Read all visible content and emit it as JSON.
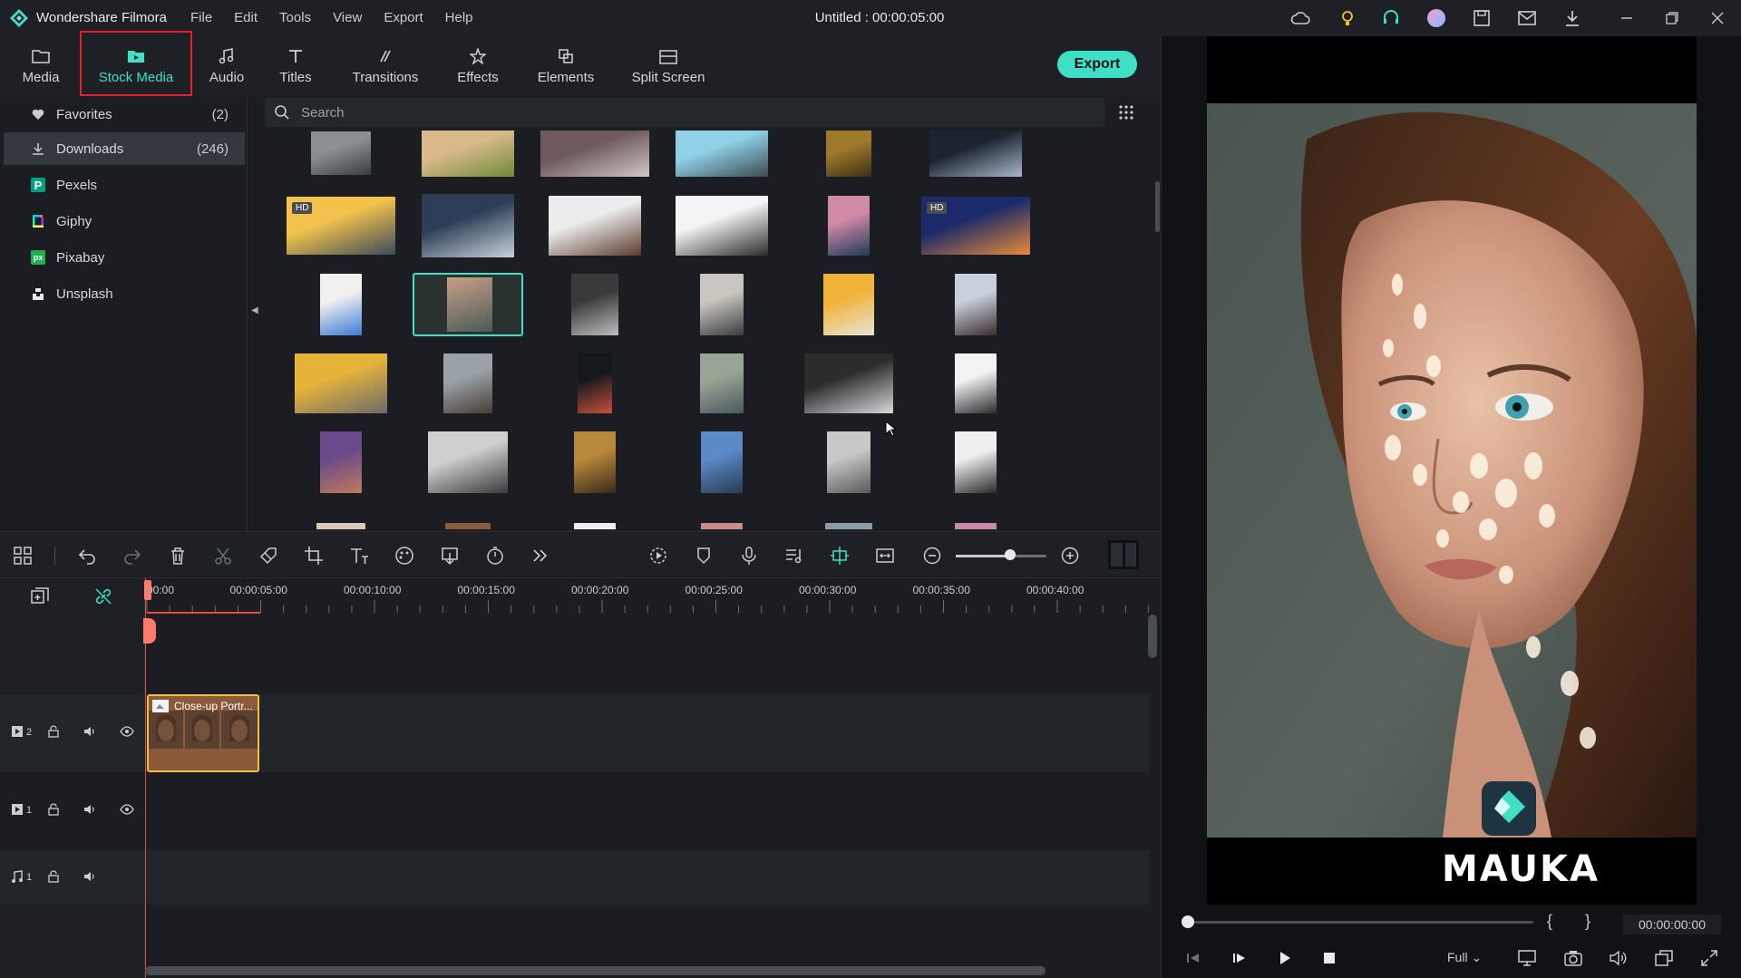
{
  "app": {
    "name": "Wondershare Filmora",
    "doc_title": "Untitled : 00:00:05:00",
    "menu": [
      "File",
      "Edit",
      "Tools",
      "View",
      "Export",
      "Help"
    ],
    "title_icons": [
      "cloud-icon",
      "bulb-icon",
      "headset-icon",
      "avatar-icon",
      "save-icon",
      "mail-icon",
      "download-icon"
    ],
    "window_controls": [
      "minimize-icon",
      "restore-icon",
      "close-icon"
    ]
  },
  "library_tabs": [
    {
      "label": "Media",
      "icon": "folder-icon",
      "active": false
    },
    {
      "label": "Stock Media",
      "icon": "stock-media-icon",
      "active": true
    },
    {
      "label": "Audio",
      "icon": "music-note-icon",
      "active": false
    },
    {
      "label": "Titles",
      "icon": "text-t-icon",
      "active": false
    },
    {
      "label": "Transitions",
      "icon": "transition-icon",
      "active": false
    },
    {
      "label": "Effects",
      "icon": "effects-icon",
      "active": false
    },
    {
      "label": "Elements",
      "icon": "elements-icon",
      "active": false
    },
    {
      "label": "Split Screen",
      "icon": "split-screen-icon",
      "active": false
    }
  ],
  "export_label": "Export",
  "sidebar": {
    "items": [
      {
        "label": "Favorites",
        "count": "(2)",
        "icon": "heart-icon",
        "active": false
      },
      {
        "label": "Downloads",
        "count": "(246)",
        "icon": "download-icon",
        "active": true
      },
      {
        "label": "Pexels",
        "count": "",
        "icon": "pexels-icon",
        "active": false
      },
      {
        "label": "Giphy",
        "count": "",
        "icon": "giphy-icon",
        "active": false
      },
      {
        "label": "Pixabay",
        "count": "",
        "icon": "pixabay-icon",
        "active": false
      },
      {
        "label": "Unsplash",
        "count": "",
        "icon": "unsplash-icon",
        "active": false
      }
    ]
  },
  "search": {
    "placeholder": "Search",
    "value": ""
  },
  "media_grid": {
    "hd_badge": "HD",
    "thumbnails": [
      {
        "name": "thumb-street-bw",
        "colors": [
          "#8b8f94",
          "#3a3d40"
        ]
      },
      {
        "name": "thumb-woman-smiling",
        "colors": [
          "#d9b98a",
          "#6f8a3a"
        ]
      },
      {
        "name": "thumb-blurred-object",
        "colors": [
          "#6e5a5c",
          "#cfc8c6"
        ]
      },
      {
        "name": "thumb-microphone",
        "colors": [
          "#8fd0e6",
          "#3d4a52"
        ]
      },
      {
        "name": "thumb-autumn-trees",
        "colors": [
          "#a07a2c",
          "#3b3015"
        ]
      },
      {
        "name": "thumb-dark-figure",
        "colors": [
          "#1c2430",
          "#a9b8cc"
        ]
      },
      {
        "name": "thumb-surfer-sunset",
        "colors": [
          "#f2c24d",
          "#3b4a5a"
        ],
        "hd": true
      },
      {
        "name": "thumb-desk-monitor",
        "colors": [
          "#2c3e55",
          "#c9d2dc"
        ]
      },
      {
        "name": "thumb-woman-laptop",
        "colors": [
          "#ececec",
          "#5a3a2a"
        ]
      },
      {
        "name": "thumb-cassette",
        "colors": [
          "#f4f4f4",
          "#2a2a2a"
        ]
      },
      {
        "name": "thumb-underwater-diver",
        "colors": [
          "#d08aa8",
          "#1e3a58"
        ]
      },
      {
        "name": "thumb-kaleidoscope",
        "colors": [
          "#1a2a6a",
          "#e88a3a"
        ],
        "hd": true
      },
      {
        "name": "thumb-two-women",
        "colors": [
          "#f2f0ee",
          "#3a7ad6"
        ]
      },
      {
        "name": "thumb-portrait-woman",
        "colors": [
          "#4c5a58",
          "#c8a088"
        ],
        "selected": true
      },
      {
        "name": "thumb-street-sign-bw",
        "colors": [
          "#3a3a3a",
          "#bdbdbd"
        ]
      },
      {
        "name": "thumb-camera-hands",
        "colors": [
          "#c9c6c0",
          "#3a3c40"
        ]
      },
      {
        "name": "thumb-yellow-dress",
        "colors": [
          "#f0b43a",
          "#e9e2d4"
        ]
      },
      {
        "name": "thumb-building-night",
        "colors": [
          "#c8d0dc",
          "#3a2c2c"
        ]
      },
      {
        "name": "thumb-yellow-beetle",
        "colors": [
          "#e6b33a",
          "#6a6a6a"
        ]
      },
      {
        "name": "thumb-city-street",
        "colors": [
          "#9aa2a8",
          "#4a3c34"
        ]
      },
      {
        "name": "thumb-dark-lantern",
        "colors": [
          "#14181c",
          "#c8503a"
        ]
      },
      {
        "name": "thumb-couple-bench",
        "colors": [
          "#9aa494",
          "#4a5a5c"
        ]
      },
      {
        "name": "thumb-forest-dancer",
        "colors": [
          "#2c2c2c",
          "#d8d8d8"
        ]
      },
      {
        "name": "thumb-tshirt-man",
        "colors": [
          "#f2f2f2",
          "#2c2c2c"
        ]
      },
      {
        "name": "thumb-woman-boots",
        "colors": [
          "#6a4a8a",
          "#c07a5a"
        ]
      },
      {
        "name": "thumb-motion-crowd",
        "colors": [
          "#cfcfcf",
          "#3a3a3a"
        ]
      },
      {
        "name": "thumb-woman-plant",
        "colors": [
          "#b8893a",
          "#3a2a1c"
        ]
      },
      {
        "name": "thumb-man-denim",
        "colors": [
          "#5a8ac8",
          "#2a3a54"
        ]
      },
      {
        "name": "thumb-dancer-bw",
        "colors": [
          "#c8c8c8",
          "#5a5a5a"
        ]
      },
      {
        "name": "thumb-girl-hat-bw",
        "colors": [
          "#efefef",
          "#2a2a2a"
        ]
      },
      {
        "name": "thumb-row6-a",
        "colors": [
          "#d8c8b8",
          "#3a2a24"
        ]
      },
      {
        "name": "thumb-row6-b",
        "colors": [
          "#8a5a3a",
          "#c8a07a"
        ]
      },
      {
        "name": "thumb-row6-c",
        "colors": [
          "#efefef",
          "#dcdcdc"
        ]
      },
      {
        "name": "thumb-row6-d",
        "colors": [
          "#c88a8a",
          "#6a5a5a"
        ]
      },
      {
        "name": "thumb-row6-e",
        "colors": [
          "#8a9aa8",
          "#aab4bc"
        ]
      },
      {
        "name": "thumb-row6-f",
        "colors": [
          "#c88aa8",
          "#8a6a9a"
        ]
      }
    ]
  },
  "timeline_toolbar": {
    "tools": [
      "layout-icon",
      "undo-icon",
      "redo-icon",
      "delete-icon",
      "cut-icon",
      "tag-icon",
      "crop-icon",
      "text-icon",
      "color-icon",
      "mask-icon",
      "speed-icon",
      "more-icon"
    ],
    "right_tools": [
      "render-icon",
      "marker-icon",
      "microphone-icon",
      "audio-mix-icon",
      "snap-icon",
      "fit-icon",
      "zoom-out-icon",
      "zoom-in-icon"
    ],
    "zoom_level": 0.6
  },
  "timeline": {
    "ruler_labels": [
      "00:00",
      "00:00:05:00",
      "00:00:10:00",
      "00:00:15:00",
      "00:00:20:00",
      "00:00:25:00",
      "00:00:30:00",
      "00:00:35:00",
      "00:00:40:00"
    ],
    "tracks": [
      {
        "id": "video-2",
        "number": "2",
        "type": "video"
      },
      {
        "id": "video-1",
        "number": "1",
        "type": "video"
      },
      {
        "id": "audio-1",
        "number": "1",
        "type": "audio"
      }
    ],
    "clip": {
      "label": "Close-up Portr..."
    }
  },
  "preview": {
    "brand_text": "MAUKA",
    "timecode": "00:00:00:00",
    "quality": "Full",
    "brace_in": "{",
    "brace_out": "}",
    "progress": 0
  },
  "colors": {
    "accent": "#3fe0c5",
    "highlight": "#e5202a",
    "playhead": "#e74c3c",
    "clip_border": "#f0c23c"
  }
}
